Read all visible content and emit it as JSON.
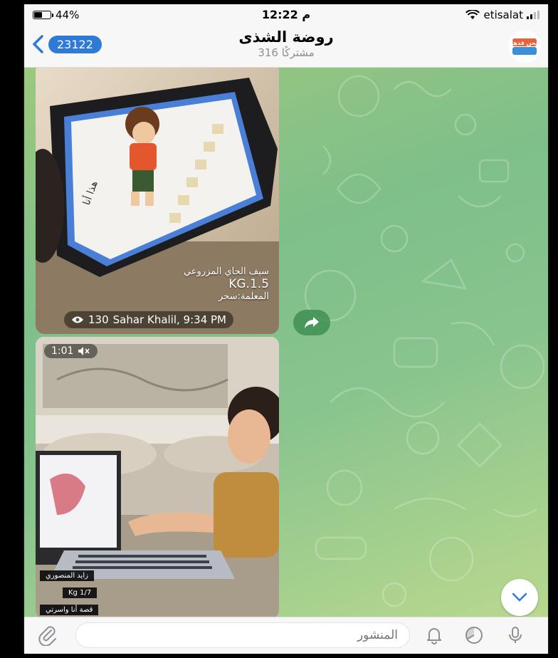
{
  "status_bar": {
    "battery": "44%",
    "battery_level": 0.44,
    "time": "12:22 م",
    "carrier": "etisalat"
  },
  "header": {
    "back_count": "23122",
    "title": "روضة الشذى",
    "subtitle": "316 مشتركًا",
    "avatar_text": "نحن قدها"
  },
  "messages": [
    {
      "caption_lines": [
        "سيف الحاي المزروعي",
        "KG.1.5",
        "المعلمة:سحر"
      ],
      "tablet_label": "هذا أنا",
      "views": "130",
      "author_time": "Sahar Khalil, 9:34 PM"
    },
    {
      "duration": "1:01",
      "tags": [
        "زايد المنصوري",
        "Kg 1/7",
        "قصة أنا واسرتي"
      ]
    }
  ],
  "composer": {
    "placeholder": "المنشور"
  },
  "colors": {
    "accent": "#2f7ad6",
    "chat_bg": "#8fc488"
  },
  "icons": [
    "back-chevron-icon",
    "eye-icon",
    "share-icon",
    "mute-icon",
    "chevron-down-icon",
    "paperclip-icon",
    "bell-icon",
    "timer-icon",
    "microphone-icon"
  ]
}
